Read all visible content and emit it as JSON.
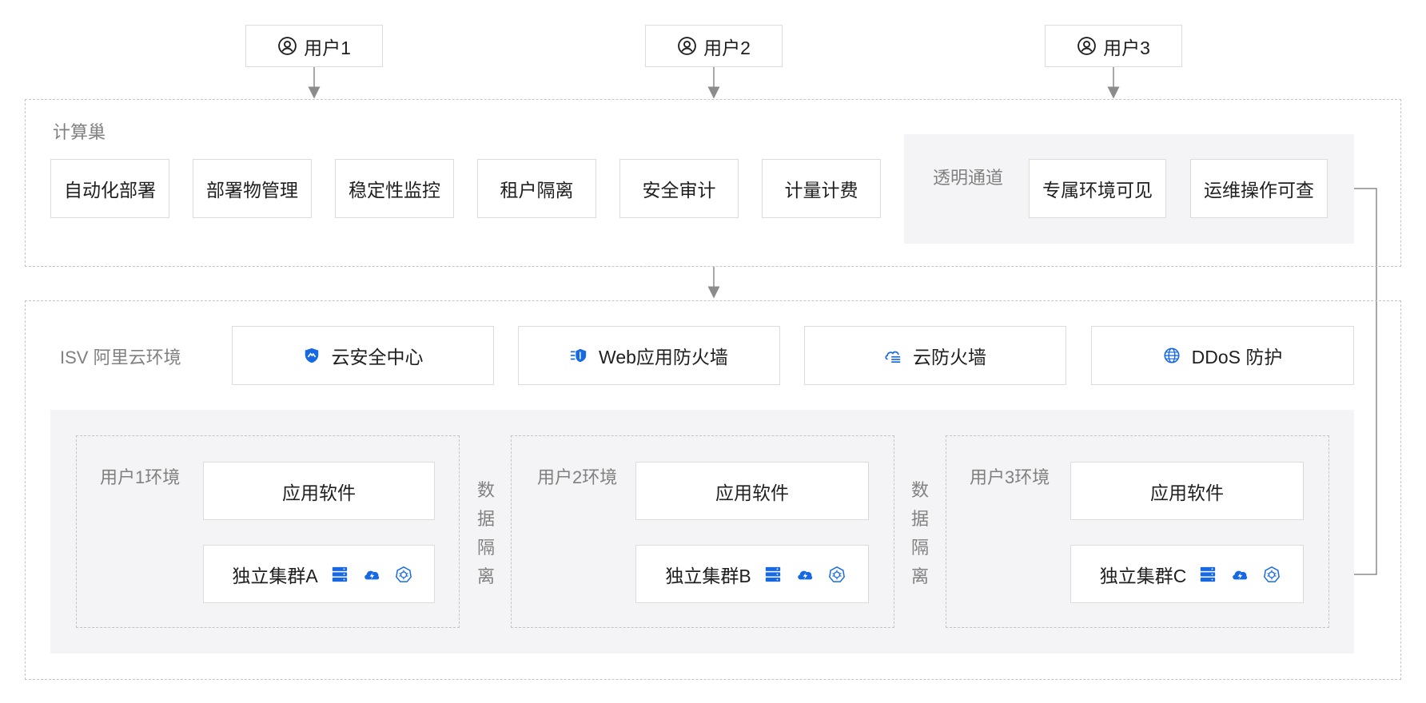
{
  "users": [
    {
      "label": "用户1",
      "icon": "user-icon"
    },
    {
      "label": "用户2",
      "icon": "user-icon"
    },
    {
      "label": "用户3",
      "icon": "user-icon"
    }
  ],
  "compute_nest": {
    "title": "计算巢",
    "features": [
      "自动化部署",
      "部署物管理",
      "稳定性监控",
      "租户隔离",
      "安全审计",
      "计量计费"
    ],
    "transparent_channel": {
      "title": "透明通道",
      "items": [
        "专属环境可见",
        "运维操作可查"
      ]
    }
  },
  "isv_env": {
    "title": "ISV 阿里云环境",
    "services": [
      {
        "label": "云安全中心",
        "icon": "shield-icon"
      },
      {
        "label": "Web应用防火墙",
        "icon": "waf-icon"
      },
      {
        "label": "云防火墙",
        "icon": "cloud-firewall-icon"
      },
      {
        "label": "DDoS 防护",
        "icon": "globe-icon"
      }
    ],
    "user_envs": [
      {
        "title": "用户1环境",
        "app": "应用软件",
        "cluster": "独立集群A"
      },
      {
        "title": "用户2环境",
        "app": "应用软件",
        "cluster": "独立集群B"
      },
      {
        "title": "用户3环境",
        "app": "应用软件",
        "cluster": "独立集群C"
      }
    ],
    "isolation": [
      "数据隔离",
      "数据隔离"
    ]
  },
  "colors": {
    "accent": "#1668e3",
    "border": "#dcdcdc",
    "panel": "#f4f4f6",
    "line": "#8c8c8c"
  }
}
